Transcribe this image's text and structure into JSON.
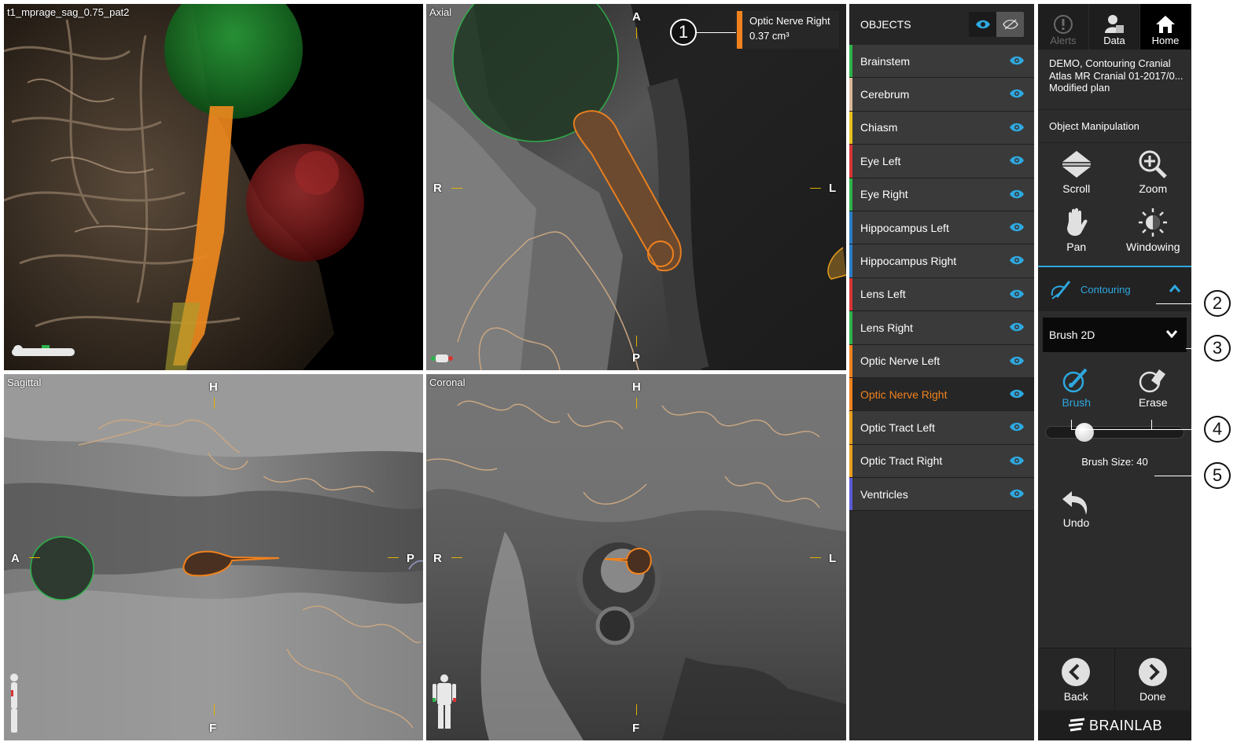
{
  "viewports": {
    "three_d": {
      "title": "t1_mprage_sag_0.75_pat2"
    },
    "axial": {
      "title": "Axial",
      "top": "A",
      "bottom": "P",
      "left": "R",
      "right": "L"
    },
    "sagittal": {
      "title": "Sagittal",
      "top": "H",
      "bottom": "F",
      "left": "A",
      "right": "P"
    },
    "coronal": {
      "title": "Coronal",
      "top": "H",
      "bottom": "F",
      "left": "R",
      "right": "L"
    }
  },
  "info_box": {
    "name": "Optic Nerve Right",
    "volume": "0.37 cm³",
    "color": "#f0821e"
  },
  "objects_panel": {
    "header": "OBJECTS",
    "items": [
      {
        "label": "Brainstem",
        "color": "#2db34a"
      },
      {
        "label": "Cerebrum",
        "color": "#d9b99b"
      },
      {
        "label": "Chiasm",
        "color": "#e8c21e"
      },
      {
        "label": "Eye Left",
        "color": "#d93434"
      },
      {
        "label": "Eye Right",
        "color": "#2db34a"
      },
      {
        "label": "Hippocampus Left",
        "color": "#2a7dc4"
      },
      {
        "label": "Hippocampus Right",
        "color": "#2a7dc4"
      },
      {
        "label": "Lens Left",
        "color": "#d93434"
      },
      {
        "label": "Lens Right",
        "color": "#2db34a"
      },
      {
        "label": "Optic Nerve Left",
        "color": "#f0821e"
      },
      {
        "label": "Optic Nerve Right",
        "color": "#f0821e",
        "selected": true
      },
      {
        "label": "Optic Tract Left",
        "color": "#e8a01e"
      },
      {
        "label": "Optic Tract Right",
        "color": "#e8a01e"
      },
      {
        "label": "Ventricles",
        "color": "#5b5bd6"
      }
    ]
  },
  "tools": {
    "tabs": {
      "alerts": "Alerts",
      "data": "Data",
      "home": "Home"
    },
    "plan": {
      "line1": "DEMO, Contouring Cranial",
      "line2": "Atlas MR Cranial 01-2017/0...",
      "line3": "Modified plan"
    },
    "section": "Object Manipulation",
    "scroll": "Scroll",
    "zoom": "Zoom",
    "pan": "Pan",
    "windowing": "Windowing",
    "contouring": "Contouring",
    "dropdown_value": "Brush 2D",
    "brush": "Brush",
    "erase": "Erase",
    "brush_size": "Brush Size: 40",
    "brush_size_fraction": 0.28,
    "undo": "Undo",
    "back": "Back",
    "done": "Done",
    "brand": "BRAINLAB",
    "accent": "#2ea8e0"
  },
  "callouts": [
    "1",
    "2",
    "3",
    "4",
    "5"
  ]
}
